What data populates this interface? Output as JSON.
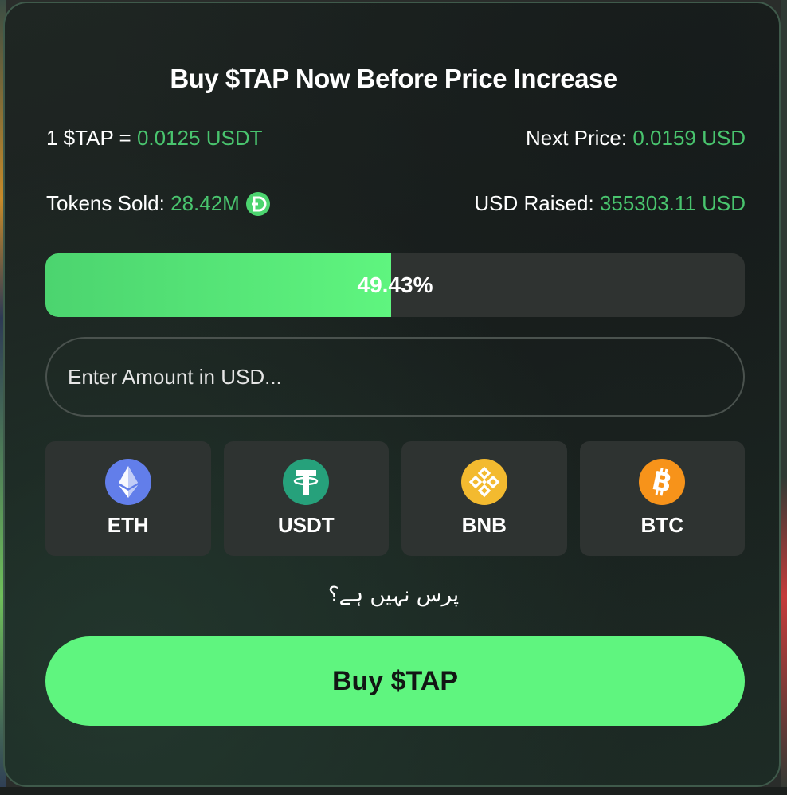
{
  "title": "Buy $TAP Now Before Price Increase",
  "price": {
    "current_label": "1 $TAP =",
    "current_value": "0.0125 USDT",
    "next_label": "Next Price:",
    "next_value": "0.0159 USD"
  },
  "stats": {
    "tokens_sold_label": "Tokens Sold:",
    "tokens_sold_value": "28.42M",
    "usd_raised_label": "USD Raised:",
    "usd_raised_value": "355303.11 USD"
  },
  "progress": {
    "label": "49.43%",
    "value": 0.4943
  },
  "amount_input": {
    "placeholder": "Enter Amount in USD..."
  },
  "coins": [
    {
      "label": "ETH",
      "icon": "ethereum-icon",
      "color": "#627eea"
    },
    {
      "label": "USDT",
      "icon": "tether-icon",
      "color": "#26a17b"
    },
    {
      "label": "BNB",
      "icon": "bnb-icon",
      "color": "#f3ba2f"
    },
    {
      "label": "BTC",
      "icon": "bitcoin-icon",
      "color": "#f7931a"
    }
  ],
  "help_text": "پرس نہیں ہے؟",
  "buy_button": "Buy $TAP",
  "colors": {
    "accent_green": "#5ff57f",
    "value_green": "#49c46e"
  }
}
